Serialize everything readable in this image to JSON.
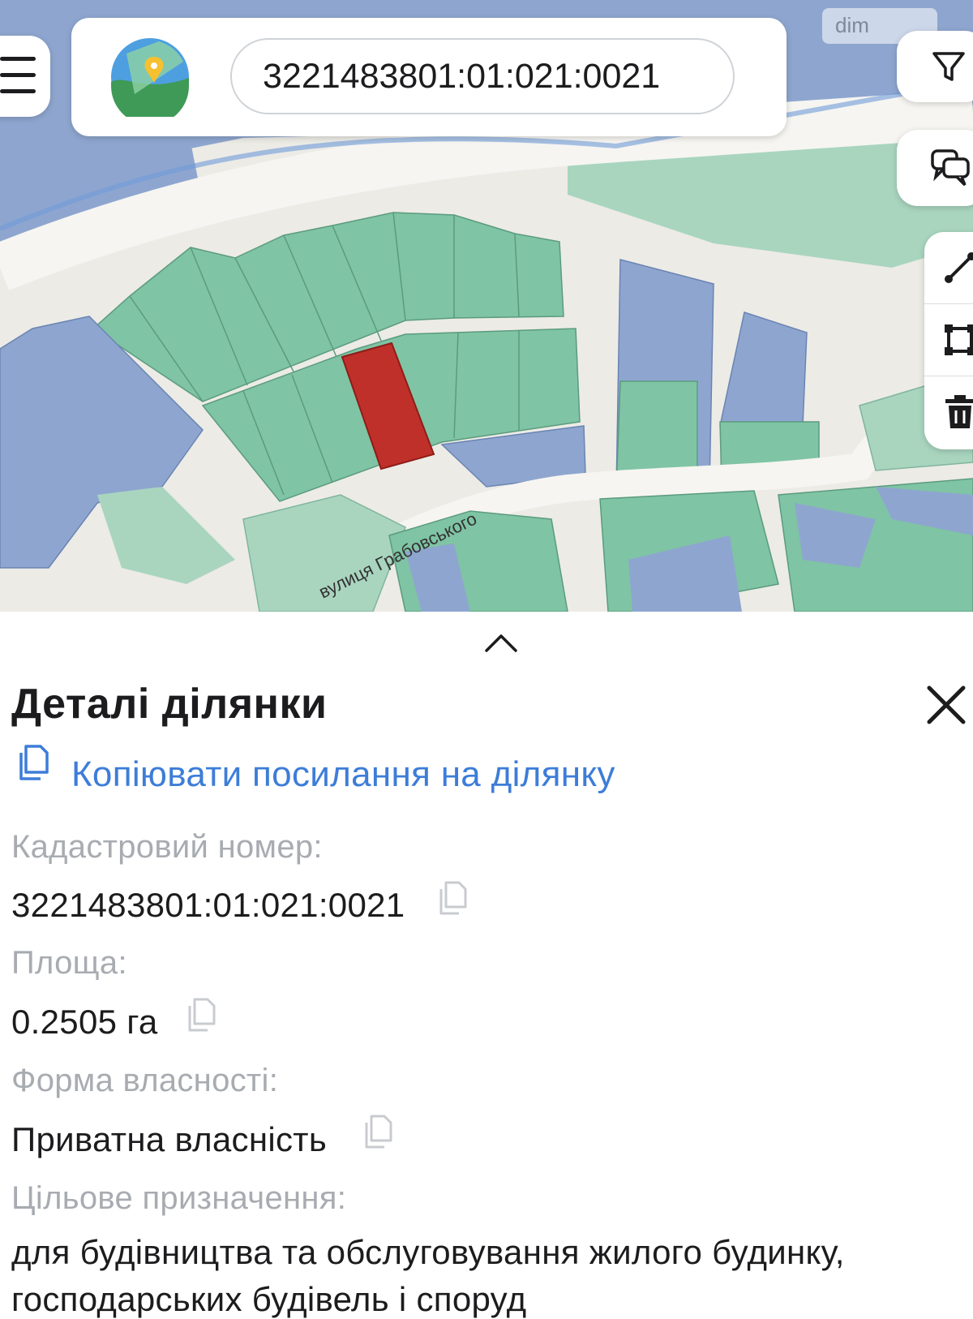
{
  "search": {
    "value": "3221483801:01:021:0021"
  },
  "map": {
    "street_label": "вулиця Грабовського",
    "watermark": "dim",
    "colors": {
      "parcel_green": "#7fc4a4",
      "parcel_blue": "#8da5cf",
      "selected_parcel": "#c0302a",
      "road": "#f6f5f1"
    }
  },
  "icons": {
    "menu": "hamburger-menu-icon",
    "logo": "map-pin-logo-icon",
    "filter": "filter-funnel-icon",
    "chat": "chat-bubbles-icon",
    "measure": "measure-line-icon",
    "polygon": "draw-polygon-icon",
    "trash": "trash-icon",
    "chevron": "chevron-up-icon",
    "close": "close-x-icon",
    "copy": "copy-icon"
  },
  "sheet": {
    "title": "Деталі ділянки",
    "copy_link": "Копіювати посилання на ділянку",
    "fields": [
      {
        "label": "Кадастровий номер:",
        "value": "3221483801:01:021:0021"
      },
      {
        "label": "Площа:",
        "value": "0.2505 га"
      },
      {
        "label": "Форма власності:",
        "value": "Приватна власність"
      },
      {
        "label": "Цільове призначення:",
        "value": "для будівництва та обслуговування жилого будинку,"
      },
      {
        "label": "",
        "value": "господарських будівель і споруд"
      }
    ]
  }
}
